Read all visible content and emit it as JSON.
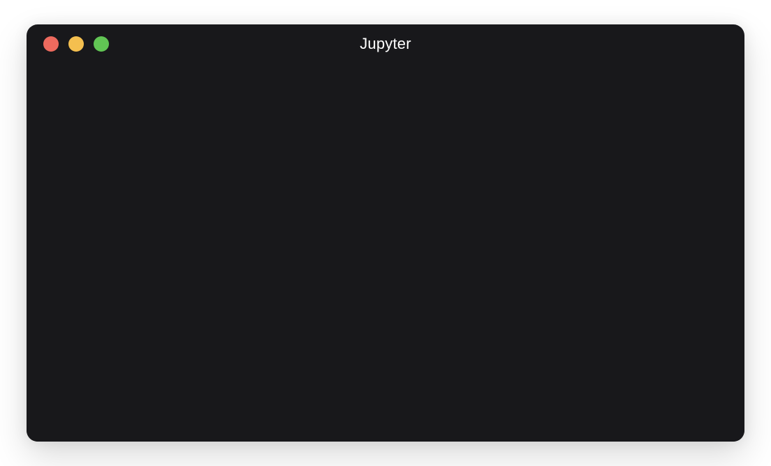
{
  "window": {
    "title": "Jupyter"
  }
}
